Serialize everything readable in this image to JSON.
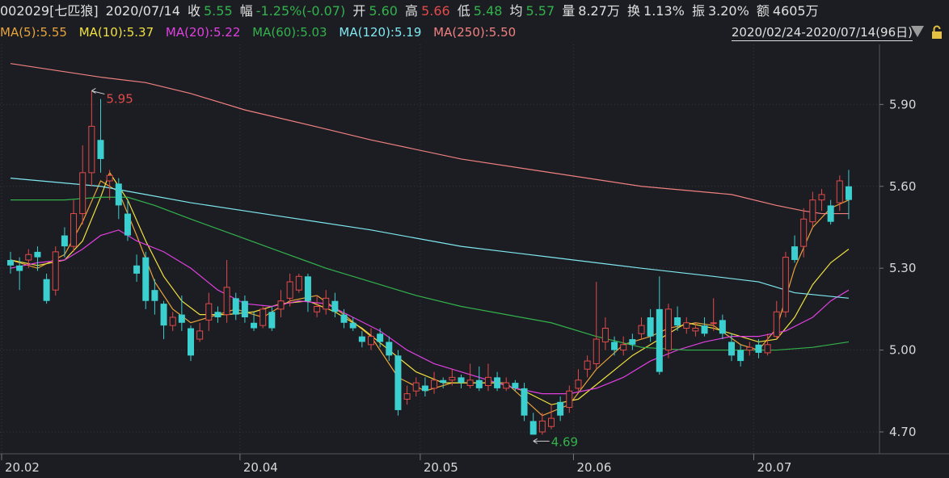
{
  "header": {
    "code_name": "002029[七匹狼]",
    "date": "2020/07/14",
    "close_label": "收",
    "close_value": "5.55",
    "chg_label": "幅",
    "chg_value": "-1.25%(-0.07)",
    "open_label": "开",
    "open_value": "5.60",
    "high_label": "高",
    "high_value": "5.66",
    "low_label": "低",
    "low_value": "5.48",
    "avg_label": "均",
    "avg_value": "5.57",
    "vol_label": "量",
    "vol_value": "8.27万",
    "turnover_label": "换",
    "turnover_value": "1.13%",
    "amp_label": "振",
    "amp_value": "3.20%",
    "amount_label": "额",
    "amount_value": "4605万"
  },
  "ma_legend": [
    {
      "text": "MA(5):5.55",
      "color": "#e8a33a"
    },
    {
      "text": "MA(10):5.37",
      "color": "#f0e040"
    },
    {
      "text": "MA(20):5.22",
      "color": "#e040e0"
    },
    {
      "text": "MA(60):5.03",
      "color": "#33b24c"
    },
    {
      "text": "MA(120):5.19",
      "color": "#7fe8f0"
    },
    {
      "text": "MA(250):5.50",
      "color": "#f08080"
    }
  ],
  "range_text": "2020/02/24-2020/07/14(96日)",
  "colors": {
    "up": "#e24a4a",
    "down": "#3ccfd0",
    "grid": "#33363d",
    "axis_text": "#d8d8d8"
  },
  "chart_data": {
    "type": "candlestick",
    "ylim": [
      4.62,
      6.12
    ],
    "y_ticks": [
      "5.90",
      "5.60",
      "5.30",
      "5.00",
      "4.70"
    ],
    "x_ticks": [
      {
        "label": "20.02",
        "index": 0
      },
      {
        "label": "20.04",
        "index": 26
      },
      {
        "label": "20.05",
        "index": 46
      },
      {
        "label": "20.06",
        "index": 63
      },
      {
        "label": "20.07",
        "index": 83
      }
    ],
    "annotations": [
      {
        "text": "5.95",
        "index": 9,
        "value": 5.95,
        "color": "#e24a4a"
      },
      {
        "text": "4.69",
        "index": 58,
        "value": 4.69,
        "color": "#33b24c"
      }
    ],
    "candles": [
      [
        5.33,
        5.31,
        5.36,
        5.28
      ],
      [
        5.31,
        5.29,
        5.34,
        5.22
      ],
      [
        5.33,
        5.35,
        5.37,
        5.3
      ],
      [
        5.36,
        5.34,
        5.38,
        5.29
      ],
      [
        5.26,
        5.18,
        5.28,
        5.17
      ],
      [
        5.22,
        5.36,
        5.38,
        5.2
      ],
      [
        5.42,
        5.38,
        5.45,
        5.34
      ],
      [
        5.38,
        5.5,
        5.55,
        5.36
      ],
      [
        5.5,
        5.65,
        5.75,
        5.46
      ],
      [
        5.65,
        5.82,
        5.95,
        5.6
      ],
      [
        5.77,
        5.7,
        5.92,
        5.65
      ],
      [
        5.62,
        5.64,
        5.66,
        5.55
      ],
      [
        5.61,
        5.53,
        5.63,
        5.48
      ],
      [
        5.5,
        5.42,
        5.55,
        5.4
      ],
      [
        5.31,
        5.28,
        5.35,
        5.25
      ],
      [
        5.34,
        5.18,
        5.36,
        5.15
      ],
      [
        5.22,
        5.18,
        5.26,
        5.13
      ],
      [
        5.17,
        5.09,
        5.18,
        5.04
      ],
      [
        5.09,
        5.12,
        5.14,
        5.07
      ],
      [
        5.13,
        5.1,
        5.2,
        5.07
      ],
      [
        5.08,
        4.98,
        5.09,
        4.96
      ],
      [
        5.04,
        5.07,
        5.1,
        5.03
      ],
      [
        5.11,
        5.17,
        5.21,
        5.07
      ],
      [
        5.14,
        5.12,
        5.16,
        5.1
      ],
      [
        5.13,
        5.23,
        5.33,
        5.1
      ],
      [
        5.19,
        5.13,
        5.21,
        5.11
      ],
      [
        5.18,
        5.12,
        5.2,
        5.1
      ],
      [
        5.1,
        5.08,
        5.14,
        5.07
      ],
      [
        5.09,
        5.15,
        5.16,
        5.08
      ],
      [
        5.14,
        5.08,
        5.16,
        5.07
      ],
      [
        5.15,
        5.18,
        5.22,
        5.12
      ],
      [
        5.19,
        5.25,
        5.28,
        5.16
      ],
      [
        5.22,
        5.27,
        5.28,
        5.21
      ],
      [
        5.27,
        5.18,
        5.28,
        5.14
      ],
      [
        5.14,
        5.16,
        5.2,
        5.12
      ],
      [
        5.15,
        5.19,
        5.22,
        5.13
      ],
      [
        5.18,
        5.14,
        5.21,
        5.12
      ],
      [
        5.13,
        5.1,
        5.15,
        5.08
      ],
      [
        5.1,
        5.08,
        5.12,
        5.07
      ],
      [
        5.05,
        5.03,
        5.07,
        5.01
      ],
      [
        5.02,
        5.05,
        5.08,
        5.0
      ],
      [
        5.06,
        5.03,
        5.08,
        5.01
      ],
      [
        5.03,
        4.98,
        5.05,
        4.96
      ],
      [
        4.98,
        4.78,
        5.0,
        4.76
      ],
      [
        4.82,
        4.84,
        4.87,
        4.8
      ],
      [
        4.85,
        4.88,
        4.9,
        4.83
      ],
      [
        4.87,
        4.85,
        4.9,
        4.83
      ],
      [
        4.86,
        4.89,
        4.92,
        4.84
      ],
      [
        4.89,
        4.88,
        4.9,
        4.86
      ],
      [
        4.89,
        4.9,
        4.93,
        4.87
      ],
      [
        4.9,
        4.88,
        4.91,
        4.86
      ],
      [
        4.87,
        4.89,
        4.95,
        4.86
      ],
      [
        4.89,
        4.86,
        4.94,
        4.85
      ],
      [
        4.87,
        4.9,
        4.95,
        4.85
      ],
      [
        4.9,
        4.86,
        4.92,
        4.85
      ],
      [
        4.86,
        4.88,
        4.9,
        4.85
      ],
      [
        4.88,
        4.86,
        4.89,
        4.85
      ],
      [
        4.86,
        4.76,
        4.88,
        4.74
      ],
      [
        4.74,
        4.69,
        4.77,
        4.69
      ],
      [
        4.7,
        4.74,
        4.77,
        4.69
      ],
      [
        4.72,
        4.75,
        4.8,
        4.71
      ],
      [
        4.81,
        4.76,
        4.83,
        4.74
      ],
      [
        4.79,
        4.85,
        4.87,
        4.77
      ],
      [
        4.86,
        4.89,
        4.93,
        4.85
      ],
      [
        4.93,
        4.96,
        4.98,
        4.9
      ],
      [
        4.95,
        5.04,
        5.25,
        4.93
      ],
      [
        5.03,
        5.08,
        5.12,
        5.0
      ],
      [
        5.03,
        5.0,
        5.05,
        4.98
      ],
      [
        5.0,
        5.02,
        5.05,
        4.98
      ],
      [
        5.04,
        5.02,
        5.06,
        5.0
      ],
      [
        5.06,
        5.09,
        5.12,
        5.04
      ],
      [
        5.12,
        5.05,
        5.15,
        5.03
      ],
      [
        5.15,
        4.92,
        5.27,
        4.91
      ],
      [
        5.0,
        5.15,
        5.17,
        4.97
      ],
      [
        5.12,
        5.09,
        5.16,
        5.07
      ],
      [
        5.08,
        5.1,
        5.12,
        5.06
      ],
      [
        5.07,
        5.08,
        5.1,
        5.05
      ],
      [
        5.09,
        5.06,
        5.12,
        5.05
      ],
      [
        5.1,
        5.1,
        5.19,
        5.07
      ],
      [
        5.11,
        5.06,
        5.13,
        5.04
      ],
      [
        5.03,
        4.98,
        5.06,
        4.96
      ],
      [
        5.0,
        4.96,
        5.02,
        4.94
      ],
      [
        5.0,
        5.01,
        5.03,
        4.98
      ],
      [
        5.02,
        4.99,
        5.04,
        4.97
      ],
      [
        4.99,
        5.02,
        5.06,
        4.98
      ],
      [
        5.05,
        5.14,
        5.18,
        5.04
      ],
      [
        5.14,
        5.34,
        5.36,
        5.12
      ],
      [
        5.38,
        5.33,
        5.42,
        5.32
      ],
      [
        5.38,
        5.48,
        5.52,
        5.34
      ],
      [
        5.47,
        5.55,
        5.58,
        5.45
      ],
      [
        5.55,
        5.57,
        5.59,
        5.51
      ],
      [
        5.53,
        5.47,
        5.55,
        5.46
      ],
      [
        5.54,
        5.62,
        5.64,
        5.51
      ],
      [
        5.6,
        5.55,
        5.66,
        5.48
      ]
    ],
    "ma_series": [
      {
        "name": "MA(5)",
        "color": "#e8a33a",
        "points": [
          [
            0,
            5.33
          ],
          [
            3,
            5.3
          ],
          [
            6,
            5.35
          ],
          [
            8,
            5.47
          ],
          [
            10,
            5.62
          ],
          [
            12,
            5.58
          ],
          [
            14,
            5.42
          ],
          [
            16,
            5.25
          ],
          [
            18,
            5.15
          ],
          [
            20,
            5.1
          ],
          [
            22,
            5.12
          ],
          [
            25,
            5.15
          ],
          [
            28,
            5.12
          ],
          [
            31,
            5.18
          ],
          [
            34,
            5.2
          ],
          [
            37,
            5.13
          ],
          [
            40,
            5.05
          ],
          [
            43,
            4.9
          ],
          [
            46,
            4.85
          ],
          [
            49,
            4.88
          ],
          [
            52,
            4.88
          ],
          [
            55,
            4.88
          ],
          [
            57,
            4.82
          ],
          [
            59,
            4.76
          ],
          [
            62,
            4.8
          ],
          [
            65,
            4.93
          ],
          [
            68,
            5.02
          ],
          [
            71,
            5.05
          ],
          [
            73,
            5.08
          ],
          [
            76,
            5.1
          ],
          [
            78,
            5.09
          ],
          [
            81,
            5.02
          ],
          [
            83,
            5.0
          ],
          [
            85,
            5.08
          ],
          [
            87,
            5.3
          ],
          [
            89,
            5.45
          ],
          [
            91,
            5.52
          ],
          [
            93,
            5.55
          ]
        ]
      },
      {
        "name": "MA(10)",
        "color": "#f0e040",
        "points": [
          [
            0,
            5.33
          ],
          [
            3,
            5.31
          ],
          [
            6,
            5.33
          ],
          [
            8,
            5.4
          ],
          [
            10,
            5.56
          ],
          [
            11,
            5.65
          ],
          [
            13,
            5.55
          ],
          [
            15,
            5.4
          ],
          [
            17,
            5.27
          ],
          [
            19,
            5.18
          ],
          [
            21,
            5.13
          ],
          [
            24,
            5.13
          ],
          [
            27,
            5.14
          ],
          [
            30,
            5.17
          ],
          [
            33,
            5.18
          ],
          [
            36,
            5.14
          ],
          [
            39,
            5.08
          ],
          [
            42,
            5.0
          ],
          [
            45,
            4.92
          ],
          [
            48,
            4.88
          ],
          [
            51,
            4.88
          ],
          [
            54,
            4.88
          ],
          [
            57,
            4.85
          ],
          [
            60,
            4.8
          ],
          [
            63,
            4.82
          ],
          [
            66,
            4.9
          ],
          [
            69,
            4.98
          ],
          [
            72,
            5.04
          ],
          [
            75,
            5.1
          ],
          [
            78,
            5.08
          ],
          [
            81,
            5.05
          ],
          [
            83,
            5.03
          ],
          [
            85,
            5.04
          ],
          [
            87,
            5.12
          ],
          [
            89,
            5.24
          ],
          [
            91,
            5.32
          ],
          [
            93,
            5.37
          ]
        ]
      },
      {
        "name": "MA(20)",
        "color": "#e040e0",
        "points": [
          [
            0,
            5.3
          ],
          [
            3,
            5.32
          ],
          [
            6,
            5.33
          ],
          [
            8,
            5.37
          ],
          [
            10,
            5.42
          ],
          [
            12,
            5.44
          ],
          [
            14,
            5.4
          ],
          [
            17,
            5.36
          ],
          [
            20,
            5.3
          ],
          [
            23,
            5.22
          ],
          [
            26,
            5.17
          ],
          [
            29,
            5.16
          ],
          [
            32,
            5.18
          ],
          [
            35,
            5.17
          ],
          [
            38,
            5.12
          ],
          [
            41,
            5.07
          ],
          [
            44,
            5.0
          ],
          [
            47,
            4.95
          ],
          [
            50,
            4.92
          ],
          [
            53,
            4.89
          ],
          [
            56,
            4.86
          ],
          [
            59,
            4.84
          ],
          [
            62,
            4.84
          ],
          [
            65,
            4.86
          ],
          [
            68,
            4.9
          ],
          [
            71,
            4.96
          ],
          [
            74,
            5.0
          ],
          [
            77,
            5.03
          ],
          [
            80,
            5.05
          ],
          [
            83,
            5.05
          ],
          [
            86,
            5.07
          ],
          [
            89,
            5.12
          ],
          [
            91,
            5.18
          ],
          [
            93,
            5.22
          ]
        ]
      },
      {
        "name": "MA(60)",
        "color": "#33b24c",
        "points": [
          [
            0,
            5.55
          ],
          [
            6,
            5.55
          ],
          [
            10,
            5.56
          ],
          [
            13,
            5.56
          ],
          [
            16,
            5.53
          ],
          [
            20,
            5.48
          ],
          [
            25,
            5.42
          ],
          [
            30,
            5.36
          ],
          [
            35,
            5.3
          ],
          [
            40,
            5.25
          ],
          [
            45,
            5.2
          ],
          [
            50,
            5.16
          ],
          [
            55,
            5.13
          ],
          [
            60,
            5.1
          ],
          [
            65,
            5.05
          ],
          [
            70,
            5.01
          ],
          [
            75,
            5.0
          ],
          [
            80,
            5.0
          ],
          [
            85,
            5.0
          ],
          [
            89,
            5.01
          ],
          [
            93,
            5.03
          ]
        ]
      },
      {
        "name": "MA(120)",
        "color": "#7fe8f0",
        "points": [
          [
            0,
            5.63
          ],
          [
            10,
            5.6
          ],
          [
            15,
            5.57
          ],
          [
            20,
            5.54
          ],
          [
            30,
            5.49
          ],
          [
            40,
            5.44
          ],
          [
            50,
            5.38
          ],
          [
            60,
            5.34
          ],
          [
            70,
            5.3
          ],
          [
            78,
            5.27
          ],
          [
            83,
            5.25
          ],
          [
            87,
            5.21
          ],
          [
            90,
            5.2
          ],
          [
            93,
            5.19
          ]
        ]
      },
      {
        "name": "MA(250)",
        "color": "#f08080",
        "points": [
          [
            0,
            6.05
          ],
          [
            10,
            6.0
          ],
          [
            15,
            5.98
          ],
          [
            20,
            5.94
          ],
          [
            26,
            5.88
          ],
          [
            35,
            5.81
          ],
          [
            40,
            5.77
          ],
          [
            50,
            5.7
          ],
          [
            60,
            5.65
          ],
          [
            70,
            5.6
          ],
          [
            80,
            5.57
          ],
          [
            85,
            5.53
          ],
          [
            88,
            5.51
          ],
          [
            90,
            5.5
          ],
          [
            93,
            5.5
          ]
        ]
      }
    ]
  }
}
